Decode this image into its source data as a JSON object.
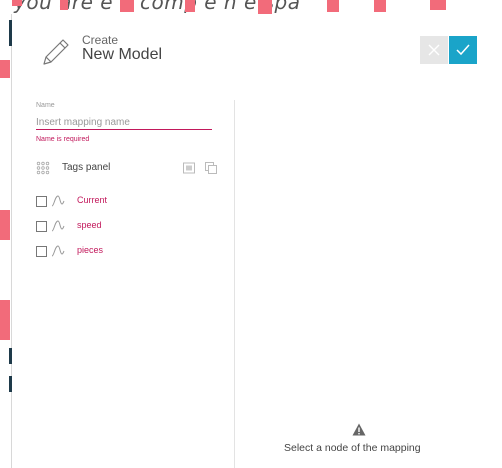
{
  "background": {
    "overlay_text": "g you are       e       n     comp e   n     e  spa"
  },
  "header": {
    "small_label": "Create",
    "title": "New Model",
    "cancel_icon": "close-icon",
    "confirm_icon": "check-icon"
  },
  "form": {
    "name_label": "Name",
    "name_placeholder": "Insert mapping name",
    "name_value": "",
    "name_error": "Name is required"
  },
  "tags_panel": {
    "label": "Tags panel",
    "items": [
      {
        "label": "Current",
        "checked": false
      },
      {
        "label": "speed",
        "checked": false
      },
      {
        "label": "pieces",
        "checked": false
      }
    ]
  },
  "detail_panel": {
    "empty_message": "Select a node of the mapping",
    "empty_icon": "warning-icon"
  },
  "colors": {
    "accent": "#1aa4c9",
    "error": "#c2185b",
    "cancel_bg": "#e6e6e6"
  }
}
